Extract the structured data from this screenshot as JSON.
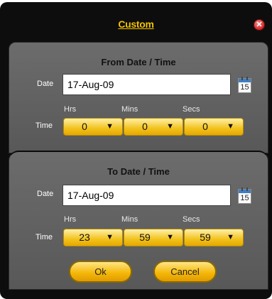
{
  "dialog": {
    "title": "Custom",
    "close_glyph": "✕",
    "close_icon": "close-icon"
  },
  "from": {
    "heading": "From Date / Time",
    "date_label": "Date",
    "date_value": "17-Aug-09",
    "calendar_day": "15",
    "time_label": "Time",
    "hrs_label": "Hrs",
    "mins_label": "Mins",
    "secs_label": "Secs",
    "hrs_value": "0",
    "mins_value": "0",
    "secs_value": "0"
  },
  "to": {
    "heading": "To Date / Time",
    "date_label": "Date",
    "date_value": "17-Aug-09",
    "calendar_day": "15",
    "time_label": "Time",
    "hrs_label": "Hrs",
    "mins_label": "Mins",
    "secs_label": "Secs",
    "hrs_value": "23",
    "mins_value": "59",
    "secs_value": "59"
  },
  "buttons": {
    "ok": "Ok",
    "cancel": "Cancel"
  },
  "icons": {
    "dropdown_arrow": "▼",
    "calendar": "calendar-icon"
  },
  "colors": {
    "accent": "#f2c200",
    "dialog_bg": "#0d0d0d",
    "panel_bg": "#626262",
    "close": "#d21b1b"
  }
}
